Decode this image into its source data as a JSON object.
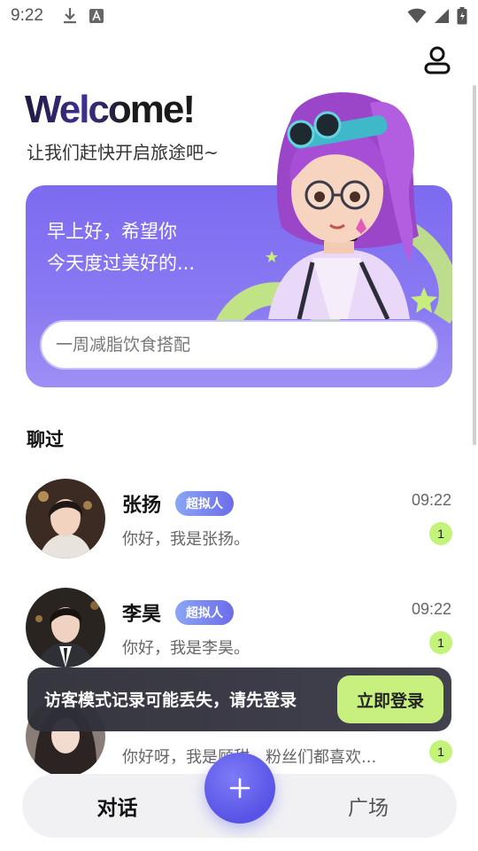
{
  "status_bar": {
    "time": "9:22"
  },
  "header": {
    "welcome_title": "Welcome!",
    "welcome_subtitle": "让我们赶快开启旅途吧~"
  },
  "greeting_card": {
    "line1": "早上好，希望你",
    "line2": "今天度过美好的...",
    "search_placeholder": "一周减脂饮食搭配"
  },
  "chats": {
    "section_title": "聊过",
    "items": [
      {
        "name": "张扬",
        "badge": "超拟人",
        "time": "09:22",
        "message": "你好，我是张扬。",
        "unread": "1"
      },
      {
        "name": "李昊",
        "badge": "超拟人",
        "time": "09:22",
        "message": "你好，我是李昊。",
        "unread": "1"
      },
      {
        "name": "",
        "badge": "",
        "time": "",
        "message": "你好呀，我是顾甜，粉丝们都喜欢...",
        "unread": "1"
      }
    ]
  },
  "login_toast": {
    "message": "访客模式记录可能丢失，请先登录",
    "button_label": "立即登录"
  },
  "bottom_nav": {
    "chat_label": "对话",
    "plaza_label": "广场"
  },
  "colors": {
    "card_purple": "#7c6bf0",
    "accent_green": "#c6f07a",
    "fab_blue": "#5853e6"
  }
}
